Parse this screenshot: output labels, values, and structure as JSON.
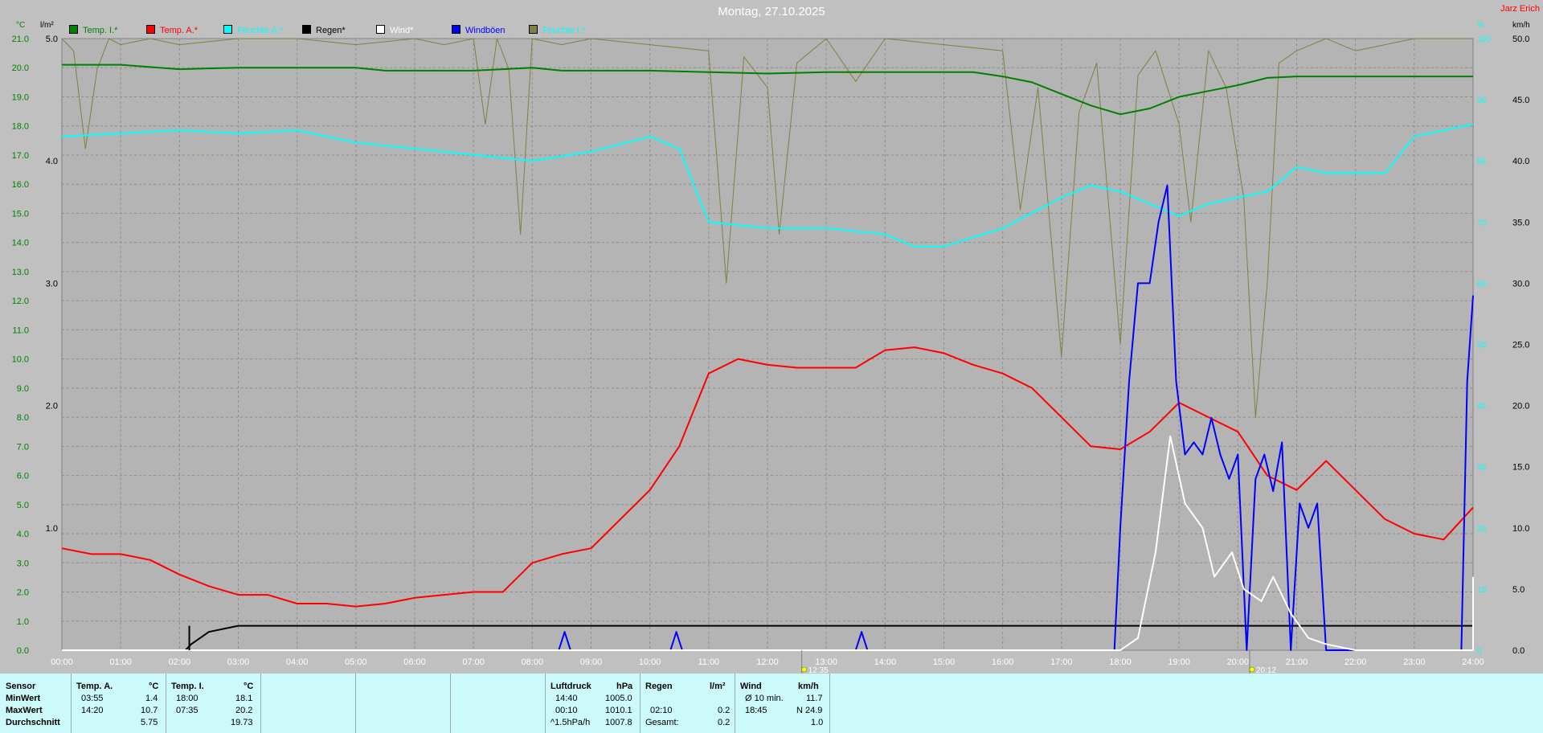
{
  "header": {
    "title": "Montag, 27.10.2025",
    "brand": "Jarz Erich"
  },
  "legend": [
    {
      "label": "Temp. I.*",
      "color": "#008000"
    },
    {
      "label": "Temp. A.*",
      "color": "#ff0000"
    },
    {
      "label": "Feuchte A.*",
      "color": "#00ffff"
    },
    {
      "label": "Regen*",
      "color": "#000000"
    },
    {
      "label": "Wind*",
      "color": "#ffffff"
    },
    {
      "label": "Windböen",
      "color": "#0000ff"
    },
    {
      "label": "Feuchte I.*",
      "color": "#808040"
    }
  ],
  "axes": {
    "temp_unit": "°C",
    "rain_unit": "l/m²",
    "hum_unit": "%",
    "wind_unit": "km/h",
    "temp_ticks": [
      "0.0",
      "1.0",
      "2.0",
      "3.0",
      "4.0",
      "5.0",
      "6.0",
      "7.0",
      "8.0",
      "9.0",
      "10.0",
      "11.0",
      "12.0",
      "13.0",
      "14.0",
      "15.0",
      "16.0",
      "17.0",
      "18.0",
      "19.0",
      "20.0",
      "21.0"
    ],
    "rain_ticks": [
      "1.0",
      "2.0",
      "3.0",
      "4.0",
      "5.0"
    ],
    "hum_ticks": [
      "0",
      "10",
      "20",
      "30",
      "40",
      "50",
      "60",
      "70",
      "80",
      "90",
      "100"
    ],
    "wind_ticks": [
      "0.0",
      "5.0",
      "10.0",
      "15.0",
      "20.0",
      "25.0",
      "30.0",
      "35.0",
      "40.0",
      "45.0",
      "50.0"
    ],
    "x_ticks": [
      "00:00",
      "01:00",
      "02:00",
      "03:00",
      "04:00",
      "05:00",
      "06:00",
      "07:00",
      "08:00",
      "09:00",
      "10:00",
      "11:00",
      "12:00",
      "13:00",
      "14:00",
      "15:00",
      "16:00",
      "17:00",
      "18:00",
      "19:00",
      "20:00",
      "21:00",
      "22:00",
      "23:00",
      "24:00"
    ]
  },
  "markers": [
    {
      "label": "12:35",
      "time": 12.583
    },
    {
      "label": "20:12",
      "time": 20.2
    }
  ],
  "chart_data": {
    "type": "line",
    "xlabel": "",
    "ylabel": "°C",
    "x_range": [
      0,
      24
    ],
    "ylim_temp": [
      0,
      21
    ],
    "ylim_rain": [
      0,
      5
    ],
    "ylim_hum": [
      0,
      100
    ],
    "ylim_wind": [
      0,
      50
    ],
    "grid": true,
    "series": [
      {
        "name": "Temp. I.*",
        "axis": "temp",
        "color": "#008000",
        "points": [
          [
            0,
            20.1
          ],
          [
            1,
            20.1
          ],
          [
            2,
            19.95
          ],
          [
            3,
            20.0
          ],
          [
            4,
            20.0
          ],
          [
            5,
            20.0
          ],
          [
            5.5,
            19.9
          ],
          [
            6,
            19.9
          ],
          [
            7,
            19.9
          ],
          [
            7.5,
            19.95
          ],
          [
            8,
            20.0
          ],
          [
            8.5,
            19.9
          ],
          [
            9,
            19.9
          ],
          [
            10,
            19.9
          ],
          [
            11,
            19.85
          ],
          [
            12,
            19.8
          ],
          [
            13,
            19.85
          ],
          [
            14,
            19.85
          ],
          [
            15,
            19.85
          ],
          [
            15.5,
            19.85
          ],
          [
            16,
            19.7
          ],
          [
            16.5,
            19.5
          ],
          [
            17,
            19.1
          ],
          [
            17.5,
            18.7
          ],
          [
            18,
            18.4
          ],
          [
            18.5,
            18.6
          ],
          [
            19,
            19.0
          ],
          [
            19.5,
            19.2
          ],
          [
            20,
            19.4
          ],
          [
            20.5,
            19.65
          ],
          [
            21,
            19.7
          ],
          [
            22,
            19.7
          ],
          [
            23,
            19.7
          ],
          [
            24,
            19.7
          ]
        ]
      },
      {
        "name": "Temp. A.*",
        "axis": "temp",
        "color": "#ff0000",
        "points": [
          [
            0,
            3.5
          ],
          [
            0.5,
            3.3
          ],
          [
            1,
            3.3
          ],
          [
            1.5,
            3.1
          ],
          [
            2,
            2.6
          ],
          [
            2.5,
            2.2
          ],
          [
            3,
            1.9
          ],
          [
            3.5,
            1.9
          ],
          [
            4,
            1.6
          ],
          [
            4.5,
            1.6
          ],
          [
            5,
            1.5
          ],
          [
            5.5,
            1.6
          ],
          [
            6,
            1.8
          ],
          [
            6.5,
            1.9
          ],
          [
            7,
            2.0
          ],
          [
            7.5,
            2.0
          ],
          [
            8,
            3.0
          ],
          [
            8.5,
            3.3
          ],
          [
            9,
            3.5
          ],
          [
            9.5,
            4.5
          ],
          [
            10,
            5.5
          ],
          [
            10.5,
            7.0
          ],
          [
            11,
            9.5
          ],
          [
            11.5,
            10.0
          ],
          [
            12,
            9.8
          ],
          [
            12.5,
            9.7
          ],
          [
            13,
            9.7
          ],
          [
            13.5,
            9.7
          ],
          [
            14,
            10.3
          ],
          [
            14.5,
            10.4
          ],
          [
            15,
            10.2
          ],
          [
            15.5,
            9.8
          ],
          [
            16,
            9.5
          ],
          [
            16.5,
            9.0
          ],
          [
            17,
            8.0
          ],
          [
            17.5,
            7.0
          ],
          [
            18,
            6.9
          ],
          [
            18.5,
            7.5
          ],
          [
            19,
            8.5
          ],
          [
            19.5,
            8.0
          ],
          [
            20,
            7.5
          ],
          [
            20.5,
            6.0
          ],
          [
            21,
            5.5
          ],
          [
            21.5,
            6.5
          ],
          [
            22,
            5.5
          ],
          [
            22.5,
            4.5
          ],
          [
            23,
            4.0
          ],
          [
            23.5,
            3.8
          ],
          [
            24,
            4.9
          ]
        ]
      },
      {
        "name": "Feuchte A.*",
        "axis": "hum",
        "color": "#00ffff",
        "points": [
          [
            0,
            84
          ],
          [
            1,
            84.5
          ],
          [
            2,
            85
          ],
          [
            3,
            84.5
          ],
          [
            4,
            85
          ],
          [
            5,
            83
          ],
          [
            6,
            82
          ],
          [
            7,
            81
          ],
          [
            8,
            80
          ],
          [
            9,
            81.5
          ],
          [
            10,
            84
          ],
          [
            10.5,
            82
          ],
          [
            11,
            70
          ],
          [
            12,
            69
          ],
          [
            13,
            69
          ],
          [
            14,
            68
          ],
          [
            14.5,
            66
          ],
          [
            15,
            66
          ],
          [
            16,
            69
          ],
          [
            17,
            74
          ],
          [
            17.5,
            76
          ],
          [
            18,
            75
          ],
          [
            18.5,
            73
          ],
          [
            19,
            71
          ],
          [
            19.5,
            73
          ],
          [
            20,
            74
          ],
          [
            20.5,
            75
          ],
          [
            21,
            79
          ],
          [
            21.5,
            78
          ],
          [
            22,
            78
          ],
          [
            22.5,
            78
          ],
          [
            23,
            84
          ],
          [
            24,
            86
          ]
        ]
      },
      {
        "name": "Regen*",
        "axis": "rain",
        "color": "#000000",
        "points": [
          [
            0,
            0
          ],
          [
            2.1,
            0
          ],
          [
            2.2,
            0.05
          ],
          [
            2.5,
            0.15
          ],
          [
            3,
            0.2
          ],
          [
            24,
            0.2
          ]
        ]
      },
      {
        "name": "Wind*",
        "axis": "wind",
        "color": "#ffffff",
        "points": [
          [
            0,
            0
          ],
          [
            18,
            0
          ],
          [
            18.3,
            1
          ],
          [
            18.6,
            8
          ],
          [
            18.85,
            17.5
          ],
          [
            19.1,
            12
          ],
          [
            19.4,
            10
          ],
          [
            19.6,
            6
          ],
          [
            19.9,
            8
          ],
          [
            20.1,
            5
          ],
          [
            20.4,
            4
          ],
          [
            20.6,
            6
          ],
          [
            20.9,
            3
          ],
          [
            21.2,
            1
          ],
          [
            21.5,
            0.5
          ],
          [
            22,
            0
          ],
          [
            24,
            0
          ],
          [
            24,
            6
          ]
        ]
      },
      {
        "name": "Windböen",
        "axis": "wind",
        "color": "#0000ff",
        "points": [
          [
            0,
            0
          ],
          [
            8.45,
            0
          ],
          [
            8.55,
            1.5
          ],
          [
            8.65,
            0
          ],
          [
            10.35,
            0
          ],
          [
            10.45,
            1.5
          ],
          [
            10.55,
            0
          ],
          [
            13.5,
            0
          ],
          [
            13.6,
            1.5
          ],
          [
            13.7,
            0
          ],
          [
            17.9,
            0
          ],
          [
            18.0,
            10
          ],
          [
            18.15,
            22
          ],
          [
            18.3,
            30
          ],
          [
            18.5,
            30
          ],
          [
            18.65,
            35
          ],
          [
            18.8,
            38
          ],
          [
            18.95,
            22
          ],
          [
            19.1,
            16
          ],
          [
            19.25,
            17
          ],
          [
            19.4,
            16
          ],
          [
            19.55,
            19
          ],
          [
            19.7,
            16
          ],
          [
            19.85,
            14
          ],
          [
            20.0,
            16
          ],
          [
            20.15,
            0
          ],
          [
            20.3,
            14
          ],
          [
            20.45,
            16
          ],
          [
            20.6,
            13
          ],
          [
            20.75,
            17
          ],
          [
            20.9,
            0
          ],
          [
            21.05,
            12
          ],
          [
            21.2,
            10
          ],
          [
            21.35,
            12
          ],
          [
            21.5,
            0
          ],
          [
            23.8,
            0
          ],
          [
            23.9,
            22
          ],
          [
            24,
            29
          ]
        ]
      },
      {
        "name": "Feuchte I.*",
        "axis": "hum",
        "color": "#808040",
        "points": [
          [
            0,
            100
          ],
          [
            0.2,
            98
          ],
          [
            0.4,
            82
          ],
          [
            0.6,
            95
          ],
          [
            0.8,
            100
          ],
          [
            1,
            99
          ],
          [
            1.5,
            100
          ],
          [
            2,
            99
          ],
          [
            3,
            100
          ],
          [
            4,
            100
          ],
          [
            5,
            99
          ],
          [
            6,
            100
          ],
          [
            6.5,
            99
          ],
          [
            7,
            100
          ],
          [
            7.2,
            86
          ],
          [
            7.4,
            100
          ],
          [
            7.6,
            95
          ],
          [
            7.8,
            68
          ],
          [
            8,
            100
          ],
          [
            8.5,
            99
          ],
          [
            9,
            100
          ],
          [
            10,
            99
          ],
          [
            11,
            98
          ],
          [
            11.3,
            60
          ],
          [
            11.6,
            97
          ],
          [
            12,
            92
          ],
          [
            12.2,
            68
          ],
          [
            12.5,
            96
          ],
          [
            13,
            100
          ],
          [
            13.5,
            93
          ],
          [
            14,
            100
          ],
          [
            15,
            99
          ],
          [
            16,
            98
          ],
          [
            16.3,
            72
          ],
          [
            16.6,
            92
          ],
          [
            17,
            48
          ],
          [
            17.3,
            88
          ],
          [
            17.6,
            96
          ],
          [
            18,
            50
          ],
          [
            18.3,
            94
          ],
          [
            18.6,
            98
          ],
          [
            19,
            86
          ],
          [
            19.2,
            70
          ],
          [
            19.5,
            98
          ],
          [
            19.8,
            92
          ],
          [
            20.1,
            74
          ],
          [
            20.3,
            38
          ],
          [
            20.5,
            60
          ],
          [
            20.7,
            96
          ],
          [
            21,
            98
          ],
          [
            21.5,
            100
          ],
          [
            22,
            98
          ],
          [
            23,
            100
          ],
          [
            24,
            100
          ]
        ]
      }
    ]
  },
  "panel": {
    "sensor": {
      "title": "Sensor",
      "rows": [
        "MinWert",
        "MaxWert",
        "Durchschnitt"
      ]
    },
    "temp_a": {
      "title": "Temp. A.",
      "unit": "°C",
      "min_time": "03:55",
      "min_val": "1.4",
      "max_time": "14:20",
      "max_val": "10.7",
      "avg": "5.75"
    },
    "temp_i": {
      "title": "Temp. I.",
      "unit": "°C",
      "min_time": "18:00",
      "min_val": "18.1",
      "max_time": "07:35",
      "max_val": "20.2",
      "avg": "19.73"
    },
    "pressure": {
      "title": "Luftdruck",
      "unit": "hPa",
      "min_time": "14:40",
      "min_val": "1005.0",
      "max_time": "00:10",
      "max_val": "1010.1",
      "trend_label": "^1.5hPa/h",
      "trend_val": "1007.8"
    },
    "rain": {
      "title": "Regen",
      "unit": "l/m²",
      "max_time": "02:10",
      "max_val": "0.2",
      "total_label": "Gesamt:",
      "total_val": "0.2"
    },
    "wind": {
      "title": "Wind",
      "unit": "km/h",
      "avg_label": "Ø 10 min.",
      "avg_val": "11.7",
      "max_time": "18:45",
      "max_val": "N 24.9",
      "mean_val": "1.0"
    }
  }
}
